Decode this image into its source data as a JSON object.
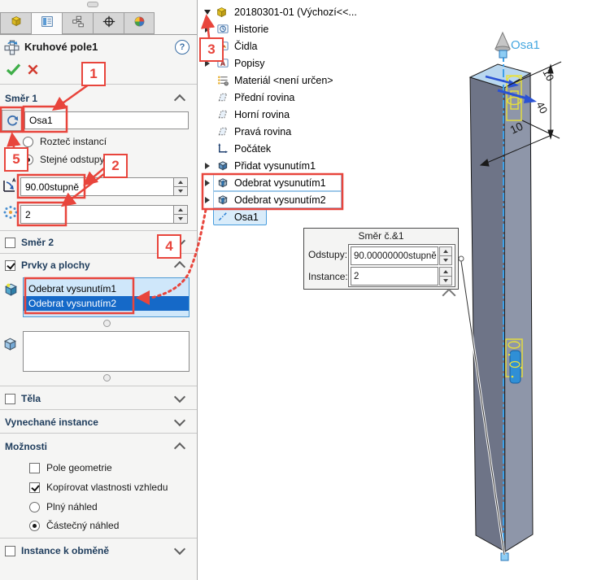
{
  "panel": {
    "tabs": [
      "part",
      "property-manager",
      "configurations",
      "dimxpert",
      "display-manager"
    ],
    "title": "Kruhové pole1",
    "help": "?",
    "dir1": {
      "label": "Směr 1",
      "axis_value": "Osa1",
      "radio_pitch": "Rozteč instancí",
      "radio_equal": "Stejné odstupy",
      "angle_value": "90.00stupně",
      "count_value": "2"
    },
    "dir2": {
      "label": "Směr 2"
    },
    "features": {
      "label": "Prvky a plochy",
      "items": [
        "Odebrat vysunutím1",
        "Odebrat vysunutím2"
      ]
    },
    "bodies": {
      "label": "Těla"
    },
    "skipped": {
      "label": "Vynechané instance"
    },
    "options": {
      "label": "Možnosti",
      "geometry_pattern": "Pole geometrie",
      "copy_appearance": "Kopírovat vlastnosti vzhledu",
      "full_preview": "Plný náhled",
      "partial_preview": "Částečný náhled"
    },
    "vary": {
      "label": "Instance k obměně"
    }
  },
  "tree": {
    "root_label": "20180301-01 (Výchozí<<...",
    "items": [
      "Historie",
      "Čidla",
      "Popisy",
      "Materiál <není určen>",
      "Přední rovina",
      "Horní rovina",
      "Pravá rovina",
      "Počátek",
      "Přidat vysunutím1",
      "Odebrat vysunutím1",
      "Odebrat vysunutím2",
      "Osa1"
    ]
  },
  "callout": {
    "title": "Směr č.&1",
    "spacing_label": "Odstupy:",
    "spacing_value": "90.00000000stupně",
    "instances_label": "Instance:",
    "instances_value": "2"
  },
  "viewport": {
    "axis_label": "Osa1",
    "dim_top": "10",
    "dim_mid": "40",
    "dim_bottom": "10"
  },
  "annotations": {
    "steps": [
      "1",
      "2",
      "3",
      "4",
      "5"
    ]
  },
  "colors": {
    "annotation_red": "#e8453c",
    "selection_blue": "#1569c8",
    "list_bg": "#cfe7fa",
    "axis_blue": "#3da0e8",
    "preview_yellow": "#e8e03a",
    "header_text": "#1e3c5c"
  }
}
